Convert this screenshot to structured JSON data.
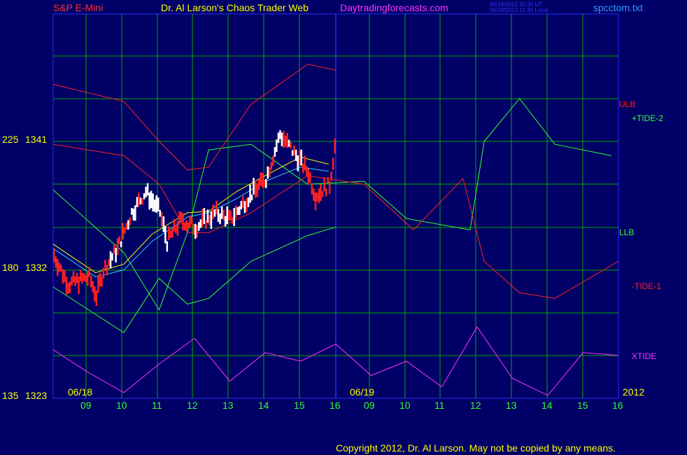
{
  "header": {
    "symbol": "S&P E-Mini",
    "title": "Dr. Al Larson's Chaos Trader Web",
    "site": "Daytradingforecasts.com",
    "stamp_ut": "06/18/2012 20:30 UT",
    "stamp_local": "06/18/2012 15:30 Local",
    "file": "spcctom.txt"
  },
  "footer": {
    "copyright": "Copyright 2012, Dr. Al Larson. May not be copied by any means."
  },
  "colors": {
    "background": "#000066",
    "grid": "#00aa00",
    "axis": "#2a2aff",
    "red": "#ff2020",
    "green": "#33ff33",
    "cyan": "#33ccff",
    "yellow": "#ffff00",
    "magenta": "#ff33ff",
    "white": "#ffffff"
  },
  "chart_data": {
    "type": "line",
    "title": "S&P E-Mini",
    "y_labels": [
      {
        "tide": "225",
        "price": "1341"
      },
      {
        "tide": "180",
        "price": "1332"
      },
      {
        "tide": "135",
        "price": "1323"
      }
    ],
    "price_range": [
      1323,
      1341
    ],
    "tide_range": [
      135,
      225
    ],
    "date_labels": [
      "06/18",
      "06/19",
      "2012"
    ],
    "hour_ticks": [
      "09",
      "10",
      "11",
      "12",
      "13",
      "14",
      "15",
      "16",
      "09",
      "10",
      "11",
      "12",
      "13",
      "14",
      "15",
      "16"
    ],
    "legend": [
      {
        "label": "ULB",
        "color": "#ff2020"
      },
      {
        "label": "+TIDE-2",
        "color": "#33ff33"
      },
      {
        "label": "LLB",
        "color": "#33ff33"
      },
      {
        "label": "-TIDE-1",
        "color": "#ff2020"
      },
      {
        "label": "XTIDE",
        "color": "#ff33ff"
      }
    ],
    "series": [
      {
        "name": "+TIDE-2",
        "x": [
          0,
          10,
          15,
          19,
          22,
          28,
          36,
          44,
          50,
          59,
          61,
          66,
          71,
          79
        ],
        "y": [
          208,
          186,
          166,
          193,
          222,
          224,
          210,
          211,
          198,
          194,
          225,
          240,
          224,
          220
        ]
      },
      {
        "name": "-TIDE-1",
        "x": [
          0,
          10,
          15,
          19,
          22,
          28,
          36,
          44,
          51,
          58,
          61,
          66,
          71,
          80
        ],
        "y": [
          224,
          220,
          210,
          193,
          193,
          200,
          213,
          210,
          194,
          212,
          183,
          172,
          170,
          183
        ]
      },
      {
        "name": "ULB",
        "x": [
          0,
          10,
          15,
          19,
          22,
          28,
          36,
          40
        ],
        "y": [
          245,
          239,
          225,
          215,
          216,
          238,
          252,
          250
        ]
      },
      {
        "name": "LLB",
        "x": [
          0,
          10,
          15,
          19,
          22,
          28,
          36,
          40
        ],
        "y": [
          174,
          158,
          177,
          168,
          170,
          183,
          192,
          195
        ]
      },
      {
        "name": "XTIDE",
        "x": [
          0,
          5,
          10,
          15,
          20,
          25,
          30,
          35,
          40,
          45,
          50,
          55,
          60,
          65,
          70,
          75,
          80
        ],
        "y": [
          152,
          144,
          137,
          147,
          156,
          141,
          151,
          148,
          154,
          143,
          148,
          139,
          160,
          142,
          136,
          151,
          150
        ]
      }
    ]
  }
}
